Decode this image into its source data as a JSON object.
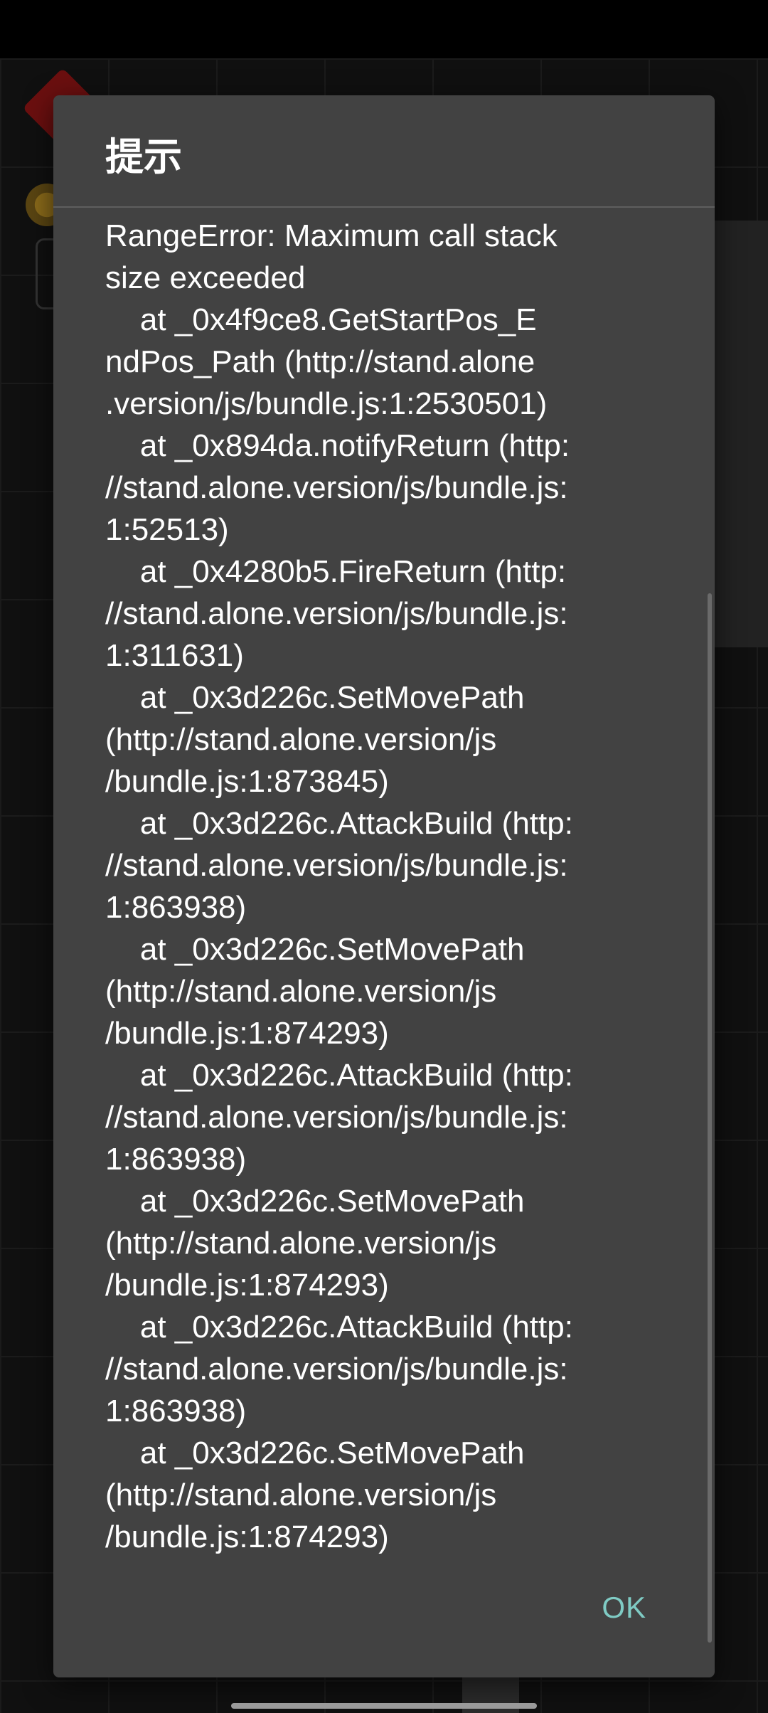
{
  "dialog": {
    "title": "提示",
    "message": "RangeError: Maximum call stack\nsize exceeded\n    at _0x4f9ce8.GetStartPos_E\nndPos_Path (http://stand.alone\n.version/js/bundle.js:1:2530501)\n    at _0x894da.notifyReturn (http:\n//stand.alone.version/js/bundle.js:\n1:52513)\n    at _0x4280b5.FireReturn (http:\n//stand.alone.version/js/bundle.js:\n1:311631)\n    at _0x3d226c.SetMovePath\n(http://stand.alone.version/js\n/bundle.js:1:873845)\n    at _0x3d226c.AttackBuild (http:\n//stand.alone.version/js/bundle.js:\n1:863938)\n    at _0x3d226c.SetMovePath\n(http://stand.alone.version/js\n/bundle.js:1:874293)\n    at _0x3d226c.AttackBuild (http:\n//stand.alone.version/js/bundle.js:\n1:863938)\n    at _0x3d226c.SetMovePath\n(http://stand.alone.version/js\n/bundle.js:1:874293)\n    at _0x3d226c.AttackBuild (http:\n//stand.alone.version/js/bundle.js:\n1:863938)\n    at _0x3d226c.SetMovePath\n(http://stand.alone.version/js\n/bundle.js:1:874293)",
    "ok_label": "OK"
  },
  "colors": {
    "dialog_background": "#424242",
    "text": "#ffffff",
    "accent_button": "#7fcbc4"
  }
}
